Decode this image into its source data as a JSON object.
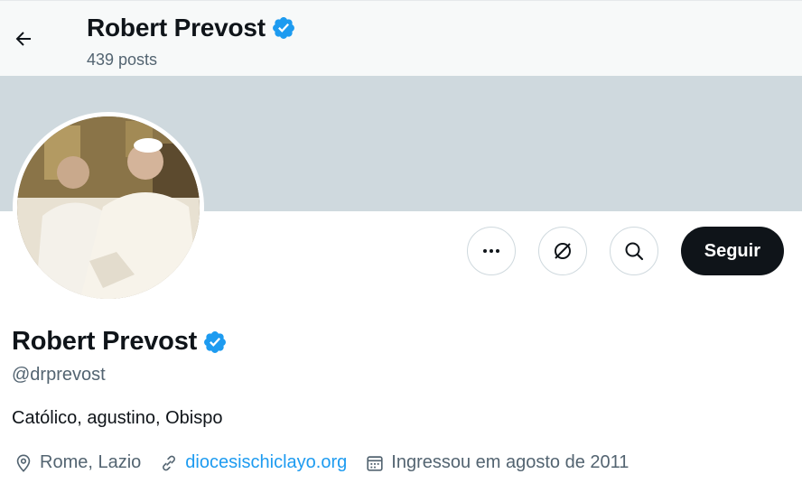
{
  "header": {
    "back_icon": "arrow-left-icon",
    "title": "Robert Prevost",
    "posts_count": "439 posts",
    "verified_icon": "verified-badge-icon"
  },
  "banner": {
    "color": "#cfd9de"
  },
  "avatar": {
    "icon": "profile-photo"
  },
  "actions": {
    "more_icon": "more-dots-icon",
    "grok_icon": "grok-icon",
    "search_icon": "search-icon",
    "follow_label": "Seguir"
  },
  "profile": {
    "name": "Robert Prevost",
    "handle": "@drprevost",
    "bio": "Católico, agustino, Obispo",
    "location": "Rome, Lazio",
    "website": "diocesischiclayo.org",
    "joined": "Ingressou em agosto de 2011"
  },
  "colors": {
    "accent": "#1d9bf0",
    "text": "#0f1419",
    "secondary": "#536471",
    "button": "#0f1419"
  }
}
